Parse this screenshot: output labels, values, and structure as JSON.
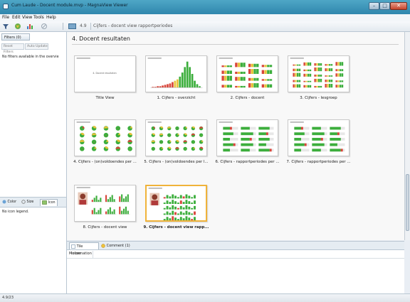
{
  "window": {
    "title": "Cum Laude - Docent module.mvp - MagnaView Viewer",
    "buttons": {
      "minimize": "–",
      "maximize": "□",
      "close": "✕"
    }
  },
  "menu": [
    "File",
    "Edit",
    "View",
    "Tools",
    "Help"
  ],
  "toolbar": {
    "icons": [
      "filter-icon",
      "globe-icon",
      "chart-icon",
      "disabled-icon"
    ],
    "view_count": "4.9",
    "view_title": "Cijfers - docent view rapportperiodes"
  },
  "left_panel": {
    "filters_tab": "Filters (0)",
    "reset_filters": "Reset Filters",
    "auto_update": "Auto Update",
    "no_filters_text": "No filters available in the overvie",
    "tabs": [
      "Color",
      "Size",
      "Icon"
    ],
    "no_icon_text": "No icon legend."
  },
  "main": {
    "section_title": "4. Docent resultaten",
    "tiles": [
      {
        "label": "Title View",
        "kind": "title",
        "selected": false
      },
      {
        "label": "1. Cijfers - overzicht",
        "kind": "histogram",
        "selected": false
      },
      {
        "label": "2. Cijfers - docent",
        "kind": "smallmultiples",
        "selected": false
      },
      {
        "label": "3. Cijfers - lesgroep",
        "kind": "smallmultiples2",
        "selected": false
      },
      {
        "label": "4. Cijfers - (on)voldoendes per ...",
        "kind": "pies",
        "selected": false
      },
      {
        "label": "5. Cijfers - (on)voldoendes per l...",
        "kind": "pies2",
        "selected": false
      },
      {
        "label": "6. Cijfers - rapportperiodes per ...",
        "kind": "bars",
        "selected": false
      },
      {
        "label": "7. Cijfers - rapportperiodes per ...",
        "kind": "bars2",
        "selected": false
      },
      {
        "label": "8. Cijfers - docent view",
        "kind": "profile",
        "selected": false
      },
      {
        "label": "9. Cijfers - docent view rapp...",
        "kind": "profile2",
        "selected": true
      }
    ],
    "title_tile_text": "4. Docent resultaten"
  },
  "bottom_panel": {
    "tabs": [
      "Tile information",
      "Comment (1)"
    ],
    "row_label": "Mouse"
  },
  "status": "4.9/23",
  "colors": {
    "selection": "#f0b33a",
    "green": "#3cae3c",
    "red": "#d8453a",
    "yellow": "#e8c23a"
  }
}
